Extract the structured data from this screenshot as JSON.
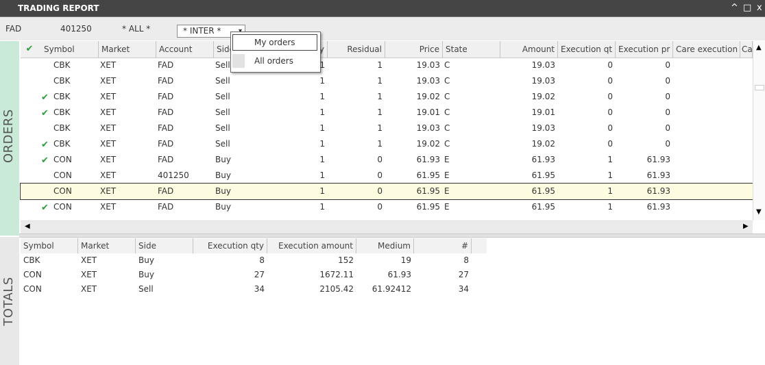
{
  "window": {
    "title": "TRADING REPORT",
    "controls": [
      "^",
      "□",
      "x"
    ]
  },
  "filters": {
    "account": "FAD",
    "number": "401250",
    "all": "* ALL *",
    "inter": "* INTER *",
    "dropdown_arrow": "chevron-down-icon"
  },
  "orders": {
    "side_label": "ORDERS",
    "header_check_icon": "checkmark-icon",
    "columns": [
      "Symbol",
      "Market",
      "Account",
      "Side",
      "y",
      "Residual",
      "Price",
      "State",
      "Amount",
      "Execution qt",
      "Execution pr",
      "Care execution",
      "Ca"
    ],
    "rows": [
      {
        "check": false,
        "symbol": "CBK",
        "market": "XET",
        "account": "FAD",
        "side": "Sell",
        "qty": "1",
        "residual": "1",
        "price": "19.03",
        "state": "C",
        "amount": "19.03",
        "exec_qty": "0",
        "exec_price": "0",
        "care": ""
      },
      {
        "check": false,
        "symbol": "CBK",
        "market": "XET",
        "account": "FAD",
        "side": "Sell",
        "qty": "1",
        "residual": "1",
        "price": "19.03",
        "state": "C",
        "amount": "19.03",
        "exec_qty": "0",
        "exec_price": "0",
        "care": ""
      },
      {
        "check": true,
        "symbol": "CBK",
        "market": "XET",
        "account": "FAD",
        "side": "Sell",
        "qty": "1",
        "residual": "1",
        "price": "19.02",
        "state": "C",
        "amount": "19.02",
        "exec_qty": "0",
        "exec_price": "0",
        "care": ""
      },
      {
        "check": true,
        "symbol": "CBK",
        "market": "XET",
        "account": "FAD",
        "side": "Sell",
        "qty": "1",
        "residual": "1",
        "price": "19.01",
        "state": "C",
        "amount": "19.01",
        "exec_qty": "0",
        "exec_price": "0",
        "care": ""
      },
      {
        "check": false,
        "symbol": "CBK",
        "market": "XET",
        "account": "FAD",
        "side": "Sell",
        "qty": "1",
        "residual": "1",
        "price": "19.03",
        "state": "C",
        "amount": "19.03",
        "exec_qty": "0",
        "exec_price": "0",
        "care": ""
      },
      {
        "check": true,
        "symbol": "CBK",
        "market": "XET",
        "account": "FAD",
        "side": "Sell",
        "qty": "1",
        "residual": "1",
        "price": "19.02",
        "state": "C",
        "amount": "19.02",
        "exec_qty": "0",
        "exec_price": "0",
        "care": ""
      },
      {
        "check": true,
        "symbol": "CON",
        "market": "XET",
        "account": "FAD",
        "side": "Buy",
        "qty": "1",
        "residual": "0",
        "price": "61.93",
        "state": "E",
        "amount": "61.93",
        "exec_qty": "1",
        "exec_price": "61.93",
        "care": ""
      },
      {
        "check": false,
        "symbol": "CON",
        "market": "XET",
        "account": "401250",
        "side": "Buy",
        "qty": "1",
        "residual": "0",
        "price": "61.95",
        "state": "E",
        "amount": "61.95",
        "exec_qty": "1",
        "exec_price": "61.93",
        "care": ""
      },
      {
        "check": false,
        "selected": true,
        "symbol": "CON",
        "market": "XET",
        "account": "FAD",
        "side": "Buy",
        "qty": "1",
        "residual": "0",
        "price": "61.95",
        "state": "E",
        "amount": "61.95",
        "exec_qty": "1",
        "exec_price": "61.93",
        "care": ""
      },
      {
        "check": true,
        "symbol": "CON",
        "market": "XET",
        "account": "FAD",
        "side": "Buy",
        "qty": "1",
        "residual": "0",
        "price": "61.95",
        "state": "E",
        "amount": "61.95",
        "exec_qty": "1",
        "exec_price": "61.93",
        "care": ""
      }
    ]
  },
  "dropdown_menu": {
    "items": [
      "My orders",
      "All orders"
    ]
  },
  "totals": {
    "side_label": "TOTALS",
    "columns": [
      "Symbol",
      "Market",
      "Side",
      "Execution qty",
      "Execution amount",
      "Medium",
      "#"
    ],
    "rows": [
      {
        "symbol": "CBK",
        "market": "XET",
        "side": "Buy",
        "exec_qty": "8",
        "exec_amount": "152",
        "medium": "19",
        "count": "8"
      },
      {
        "symbol": "CON",
        "market": "XET",
        "side": "Buy",
        "exec_qty": "27",
        "exec_amount": "1672.11",
        "medium": "61.93",
        "count": "27"
      },
      {
        "symbol": "CON",
        "market": "XET",
        "side": "Sell",
        "exec_qty": "34",
        "exec_amount": "2105.42",
        "medium": "61.92412",
        "count": "34"
      }
    ]
  },
  "colors": {
    "check": "#2e9b3e",
    "orders_strip": "#c9ead9",
    "titlebar": "#454545",
    "selected_row": "#fdfbe0"
  }
}
